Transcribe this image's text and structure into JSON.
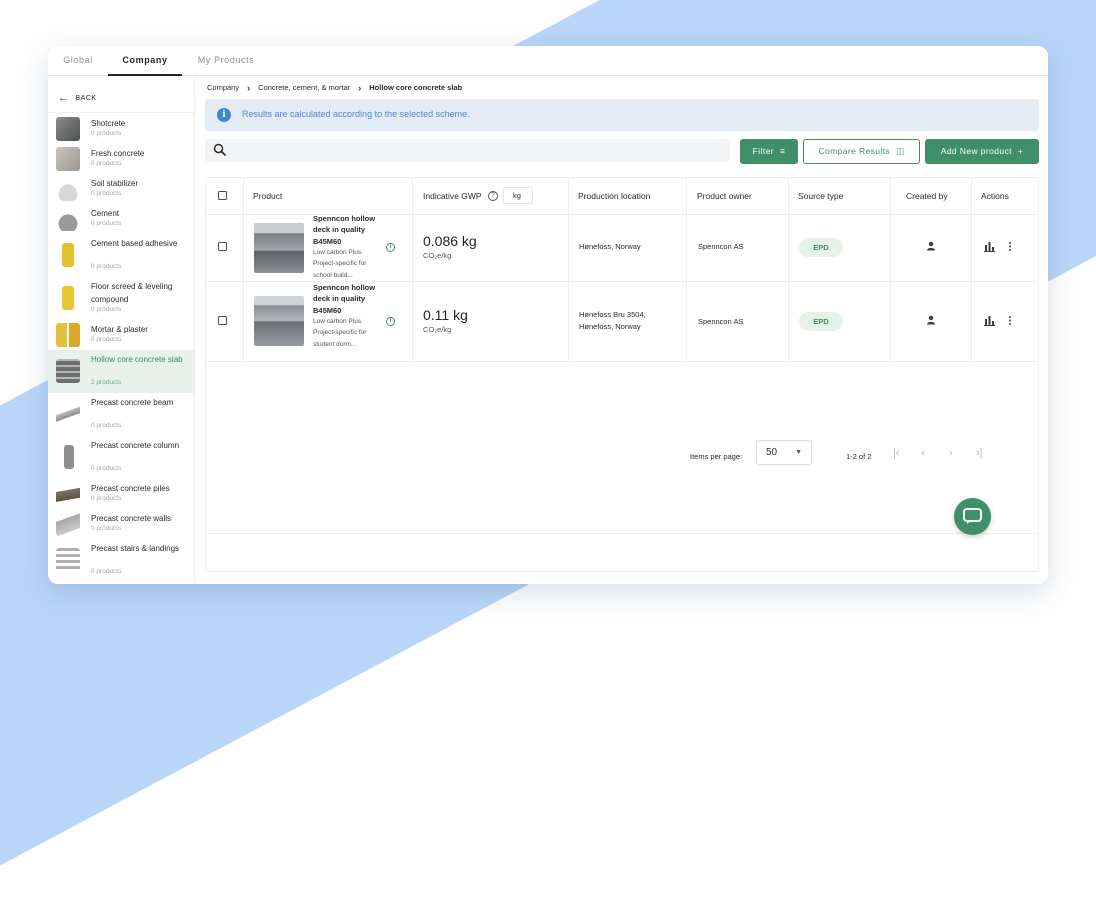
{
  "tabs": [
    {
      "label": "Global"
    },
    {
      "label": "Company"
    },
    {
      "label": "My Products"
    }
  ],
  "sidebar": {
    "back_label": "BACK",
    "items": [
      {
        "name": "Shotcrete",
        "count": "0 products"
      },
      {
        "name": "Fresh concrete",
        "count": "0 products"
      },
      {
        "name": "Soil stabilizer",
        "count": "0 products"
      },
      {
        "name": "Cement",
        "count": "0 products"
      },
      {
        "name": "Cement based adhesive",
        "count": "0 products"
      },
      {
        "name": "Floor screed & leveling compound",
        "count": "0 products"
      },
      {
        "name": "Mortar & plaster",
        "count": "0 products"
      },
      {
        "name": "Hollow core concrete slab",
        "count": "2 products"
      },
      {
        "name": "Precast concrete beam",
        "count": "0 products"
      },
      {
        "name": "Precast concrete column",
        "count": "0 products"
      },
      {
        "name": "Precast concrete piles",
        "count": "0 products"
      },
      {
        "name": "Precast concrete walls",
        "count": "0 products"
      },
      {
        "name": "Precast stairs & landings",
        "count": "0 products"
      }
    ]
  },
  "breadcrumb": [
    "Company",
    "Concrete, cement, & mortar",
    "Hollow core concrete slab"
  ],
  "banner": {
    "text": "Results are calculated according to the selected scheme."
  },
  "search": {
    "placeholder": ""
  },
  "toolbar": {
    "filter_label": "Filter",
    "compare_label": "Compare Results",
    "add_label": "Add New product"
  },
  "table": {
    "headers": {
      "product": "Product",
      "gwp": "Indicative GWP",
      "unit": "kg",
      "location": "Production location",
      "owner": "Product owner",
      "source": "Source type",
      "created": "Created by",
      "actions": "Actions"
    },
    "rows": [
      {
        "name": "Spenncon hollow deck in quality B45M60",
        "desc": "Low carbon Plus. Project-specific for school build...",
        "gwp": "0.086 kg",
        "gwp_unit": "CO₂e/kg",
        "location": "Hønefoss, Norway",
        "owner": "Spenncon AS",
        "source": "EPD"
      },
      {
        "name": "Spenncon hollow deck in quality B45M60",
        "desc": "Low carbon Plus. Project-specific for student dorm...",
        "gwp": "0.11 kg",
        "gwp_unit": "CO₂e/kg",
        "location": "Hønefoss Bru 3504, Hønefoss, Norway",
        "owner": "Spenncon AS",
        "source": "EPD"
      }
    ]
  },
  "pagination": {
    "items_per_page_label": "Items per page:",
    "items_per_page": "50",
    "range": "1-2 of 2"
  },
  "colors": {
    "accent": "#3f8f68",
    "info": "#3f86d9",
    "background_shape": "#b9d6f8"
  }
}
